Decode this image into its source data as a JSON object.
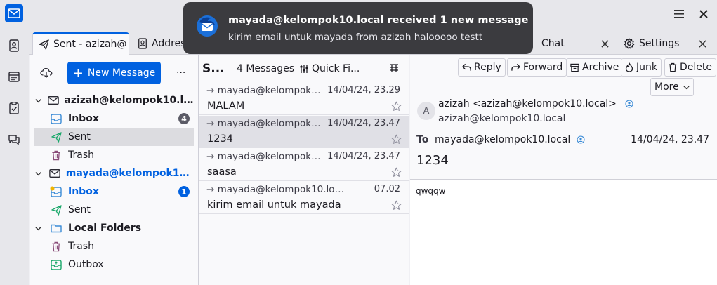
{
  "tabs": [
    {
      "label": "Sent - azizah@",
      "icon": "paper-plane-icon"
    },
    {
      "label": "Addres",
      "icon": "address-book-icon"
    },
    {
      "label": "Chat",
      "icon": "chat-icon"
    },
    {
      "label": "Settings",
      "icon": "gear-icon"
    }
  ],
  "window": {
    "menu_icon": "hamburger-menu-icon",
    "close_icon": "close-icon"
  },
  "folder_pane": {
    "new_message_label": "New Message",
    "more_label": "...",
    "folders": [
      {
        "label": "azizah@kelompok10.loca...",
        "type": "account",
        "badge": ""
      },
      {
        "label": "Inbox",
        "type": "inbox",
        "badge": "4"
      },
      {
        "label": "Sent",
        "type": "sent",
        "badge": ""
      },
      {
        "label": "Trash",
        "type": "trash",
        "badge": ""
      },
      {
        "label": "mayada@kelompok10.l...",
        "type": "account",
        "badge": ""
      },
      {
        "label": "Inbox",
        "type": "inbox",
        "badge": "1"
      },
      {
        "label": "Sent",
        "type": "sent",
        "badge": ""
      },
      {
        "label": "Local Folders",
        "type": "local",
        "badge": ""
      },
      {
        "label": "Trash",
        "type": "trash",
        "badge": ""
      },
      {
        "label": "Outbox",
        "type": "outbox",
        "badge": ""
      }
    ]
  },
  "thread_pane": {
    "folder_title": "S...",
    "message_count": "4 Messages",
    "quick_filter_label": "Quick Fi...",
    "messages": [
      {
        "from": "mayada@kelompok1...",
        "date": "14/04/24, 23.29",
        "subject": "MALAM"
      },
      {
        "from": "mayada@kelompok1...",
        "date": "14/04/24, 23.47",
        "subject": "1234"
      },
      {
        "from": "mayada@kelompok1...",
        "date": "14/04/24, 23.47",
        "subject": "saasa"
      },
      {
        "from": "mayada@kelompok10.local",
        "date": "07.02",
        "subject": "kirim email untuk mayada"
      }
    ]
  },
  "message_pane": {
    "buttons": {
      "reply": "Reply",
      "forward": "Forward",
      "archive": "Archive",
      "junk": "Junk",
      "delete": "Delete",
      "more": "More"
    },
    "avatar_letter": "A",
    "from_line": "azizah <azizah@kelompok10.local>",
    "from_address": "azizah@kelompok10.local",
    "to_label": "To",
    "to_address": "mayada@kelompok10.local",
    "date": "14/04/24, 23.47",
    "subject": "1234",
    "body": "qwqqw"
  },
  "notification": {
    "title": "mayada@kelompok10.local received 1 new message",
    "body": "kirim email untuk mayada from azizah halooooo testt"
  },
  "colors": {
    "accent": "#0061e0",
    "unread_account": "#0061e0",
    "sent": "#1aa86a",
    "notification_bg": "#3b3b3f"
  }
}
